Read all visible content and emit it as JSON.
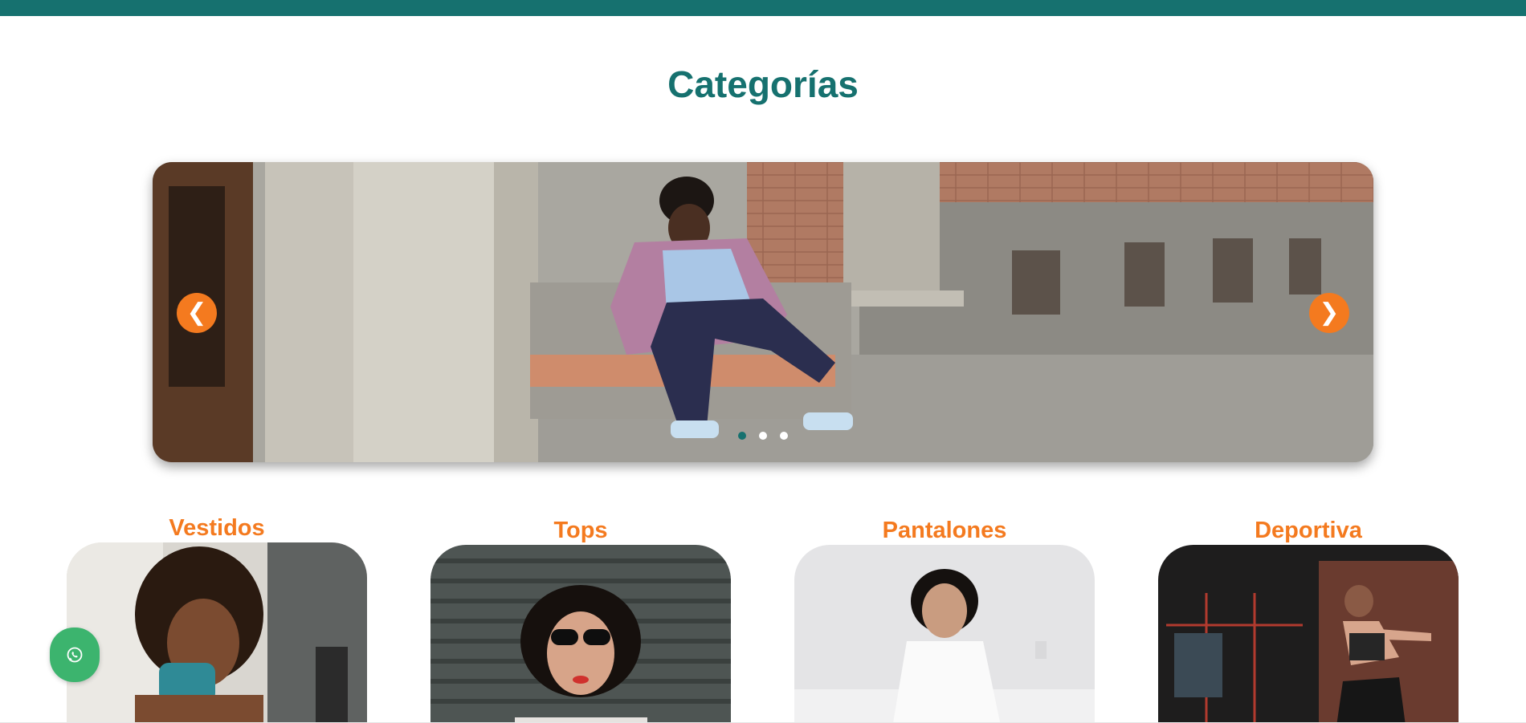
{
  "section": {
    "title": "Categorías"
  },
  "carousel": {
    "prev_label": "❮",
    "next_label": "❯",
    "slide_count": 3,
    "active_slide": 1
  },
  "categories": [
    {
      "label": "Vestidos"
    },
    {
      "label": "Tops"
    },
    {
      "label": "Pantalones"
    },
    {
      "label": "Deportiva"
    }
  ],
  "floating": {
    "icon": "whatsapp-icon"
  },
  "colors": {
    "brand_teal": "#16716f",
    "accent_orange": "#f47a1f",
    "whatsapp_green": "#3cb46e"
  }
}
